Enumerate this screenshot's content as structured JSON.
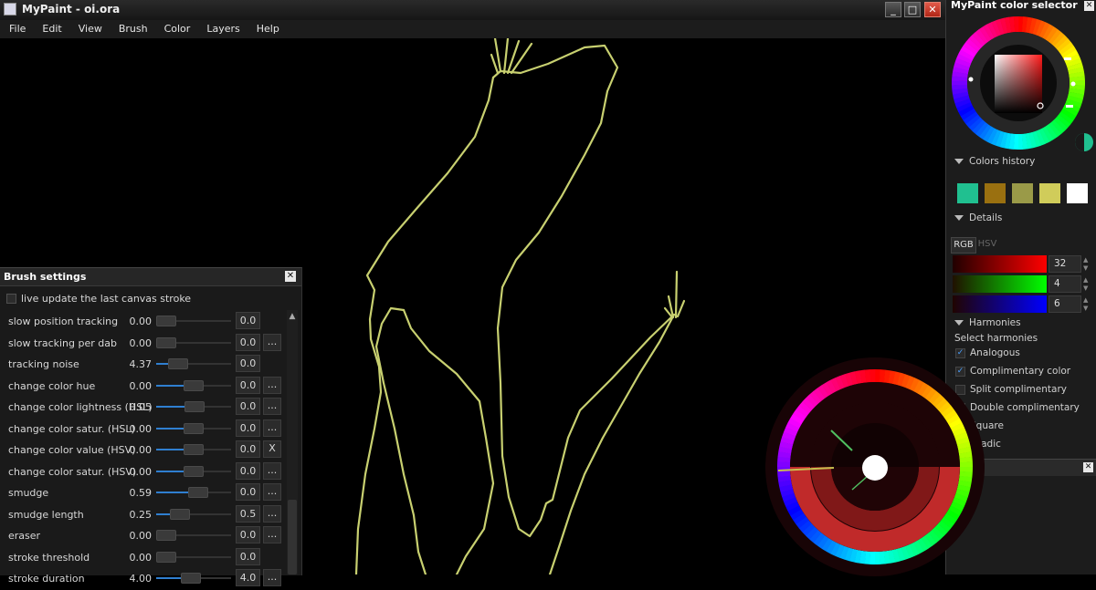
{
  "window": {
    "title": "MyPaint - oi.ora"
  },
  "menu": [
    "File",
    "Edit",
    "View",
    "Brush",
    "Color",
    "Layers",
    "Help"
  ],
  "brush_settings": {
    "title": "Brush settings",
    "live_update_label": "live update the last canvas stroke",
    "rows": [
      {
        "label": "slow position tracking",
        "value": "0.00",
        "fraction": 0.0,
        "base": "0.0",
        "more": ""
      },
      {
        "label": "slow tracking per dab",
        "value": "0.00",
        "fraction": 0.0,
        "base": "0.0",
        "more": "..."
      },
      {
        "label": "tracking noise",
        "value": "4.37",
        "fraction": 0.22,
        "base": "0.0",
        "more": ""
      },
      {
        "label": "change color hue",
        "value": "0.00",
        "fraction": 0.5,
        "base": "0.0",
        "more": "..."
      },
      {
        "label": "change color lightness (HSL)",
        "value": "0.05",
        "fraction": 0.52,
        "base": "0.0",
        "more": "..."
      },
      {
        "label": "change color satur. (HSL)",
        "value": "0.00",
        "fraction": 0.5,
        "base": "0.0",
        "more": "..."
      },
      {
        "label": "change color value (HSV)",
        "value": "0.00",
        "fraction": 0.5,
        "base": "0.0",
        "more": "X"
      },
      {
        "label": "change color satur. (HSV)",
        "value": "0.00",
        "fraction": 0.5,
        "base": "0.0",
        "more": "..."
      },
      {
        "label": "smudge",
        "value": "0.59",
        "fraction": 0.59,
        "base": "0.0",
        "more": "..."
      },
      {
        "label": "smudge length",
        "value": "0.25",
        "fraction": 0.25,
        "base": "0.5",
        "more": "..."
      },
      {
        "label": "eraser",
        "value": "0.00",
        "fraction": 0.0,
        "base": "0.0",
        "more": "..."
      },
      {
        "label": "stroke threshold",
        "value": "0.00",
        "fraction": 0.0,
        "base": "0.0",
        "more": ""
      },
      {
        "label": "stroke duration",
        "value": "4.00",
        "fraction": 0.45,
        "base": "4.0",
        "more": "..."
      }
    ]
  },
  "color_selector": {
    "title": "MyPaint color selector",
    "colors_history_label": "Colors history",
    "history": [
      "#20c090",
      "#9a7010",
      "#9a9a48",
      "#d0cc5a",
      "#ffffff"
    ],
    "details_label": "Details",
    "tabs": [
      "RGB",
      "HSV"
    ],
    "rgb": {
      "r": "32",
      "g": "4",
      "b": "6"
    },
    "harmonies_label": "Harmonies",
    "select_harmonies_label": "Select harmonies",
    "harmonies": [
      {
        "label": "Analogous",
        "checked": true
      },
      {
        "label": "Complimentary color",
        "checked": true
      },
      {
        "label": "Split complimentary",
        "checked": false
      },
      {
        "label": "Double complimentary",
        "checked": false
      },
      {
        "label": "Square",
        "checked": false
      },
      {
        "label": "Triadic",
        "checked": false
      }
    ],
    "current_color": "#200406",
    "stroke_color": "#c8d070"
  }
}
